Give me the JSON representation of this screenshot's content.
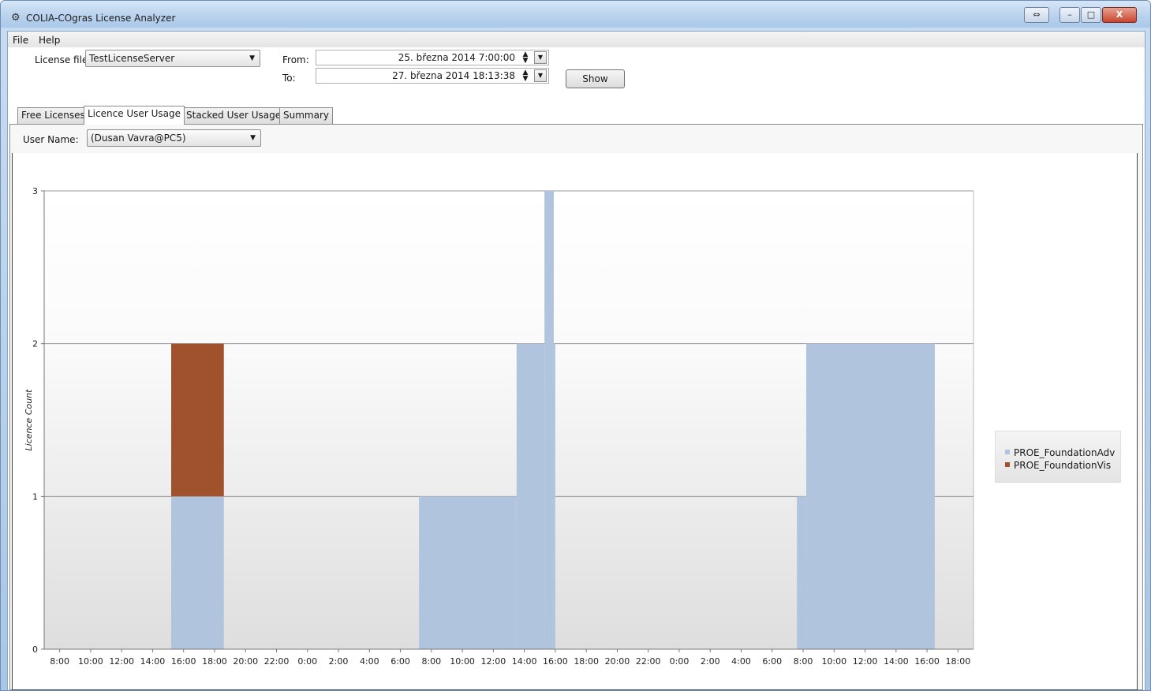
{
  "window": {
    "title": "COLIA-COgras License Analyzer",
    "app_icon": "app-icon",
    "buttons": {
      "restore_icon": "⇔",
      "minimize_icon": "–",
      "maximize_icon": "□",
      "close_icon": "X"
    }
  },
  "menu": {
    "items": [
      "File",
      "Help"
    ]
  },
  "filters": {
    "license_file_label": "License file:",
    "license_file_value": "TestLicenseServer",
    "from_label": "From:",
    "from_value": "25. března 2014 7:00:00",
    "to_label": "To:",
    "to_value": "27. března 2014 18:13:38",
    "show_button": "Show"
  },
  "tabs": [
    {
      "label": "Free Licenses",
      "active": false
    },
    {
      "label": "Licence User Usage",
      "active": true
    },
    {
      "label": "Stacked User Usage",
      "active": false
    },
    {
      "label": "Summary",
      "active": false
    }
  ],
  "user_filter": {
    "label": "User Name:",
    "value": "(Dusan Vavra@PC5)"
  },
  "colors": {
    "accent_blue": "#b0c4de",
    "accent_brown": "#a0522d",
    "gridline": "#9a9a9a"
  },
  "chart_data": {
    "type": "area",
    "stacked": true,
    "ylabel": "Licence Count",
    "ylim": [
      0,
      3
    ],
    "y_ticks": [
      0,
      1,
      2,
      3
    ],
    "x_ticks": [
      "8:00",
      "10:00",
      "12:00",
      "14:00",
      "16:00",
      "18:00",
      "20:00",
      "22:00",
      "0:00",
      "2:00",
      "4:00",
      "6:00",
      "8:00",
      "10:00",
      "12:00",
      "14:00",
      "16:00",
      "18:00",
      "20:00",
      "22:00",
      "0:00",
      "2:00",
      "4:00",
      "6:00",
      "8:00",
      "10:00",
      "12:00",
      "14:00",
      "16:00",
      "18:00"
    ],
    "x_tick_hours": [
      8,
      10,
      12,
      14,
      16,
      18,
      20,
      22,
      24,
      26,
      28,
      30,
      32,
      34,
      36,
      38,
      40,
      42,
      44,
      46,
      48,
      50,
      52,
      54,
      56,
      58,
      60,
      62,
      64,
      66
    ],
    "xlim_hours": [
      7,
      67
    ],
    "grid": true,
    "legend_position": "right",
    "series": [
      {
        "name": "PROE_FoundationAdv",
        "color": "#b0c4de",
        "steps": [
          {
            "start_hour": 15.2,
            "end_hour": 18.6,
            "value": 1
          },
          {
            "start_hour": 31.2,
            "end_hour": 37.5,
            "value": 1
          },
          {
            "start_hour": 37.5,
            "end_hour": 39.3,
            "value": 2
          },
          {
            "start_hour": 39.3,
            "end_hour": 39.9,
            "value": 3
          },
          {
            "start_hour": 39.9,
            "end_hour": 40.0,
            "value": 2
          },
          {
            "start_hour": 55.6,
            "end_hour": 56.2,
            "value": 1
          },
          {
            "start_hour": 56.2,
            "end_hour": 64.5,
            "value": 2
          }
        ]
      },
      {
        "name": "PROE_FoundationVis",
        "color": "#a0522d",
        "steps": [
          {
            "start_hour": 15.2,
            "end_hour": 18.6,
            "base": 1,
            "value": 1
          }
        ]
      }
    ]
  }
}
